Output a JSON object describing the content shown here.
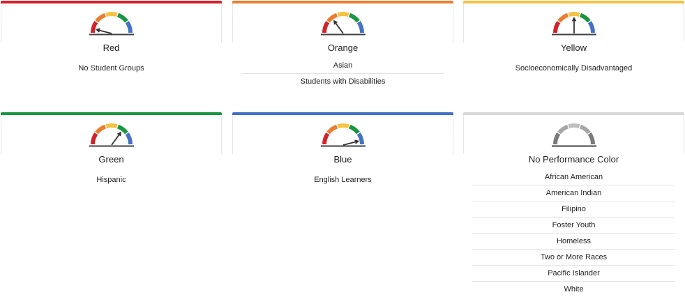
{
  "cards": [
    {
      "title": "Red",
      "bar_color": "#d1232a",
      "needle_value": 0.08,
      "gauge_style": "color",
      "groups": [
        "No Student Groups"
      ]
    },
    {
      "title": "Orange",
      "bar_color": "#ec7c30",
      "needle_value": 0.3,
      "gauge_style": "color",
      "groups": [
        "Asian",
        "Students with Disabilities"
      ]
    },
    {
      "title": "Yellow",
      "bar_color": "#f5c242",
      "needle_value": 0.5,
      "gauge_style": "color",
      "groups": [
        "Socioeconomically Disadvantaged"
      ]
    },
    {
      "title": "Green",
      "bar_color": "#1a9641",
      "needle_value": 0.7,
      "gauge_style": "color",
      "groups": [
        "Hispanic"
      ]
    },
    {
      "title": "Blue",
      "bar_color": "#4472c4",
      "needle_value": 0.92,
      "gauge_style": "color",
      "groups": [
        "English Learners"
      ]
    },
    {
      "title": "No Performance Color",
      "bar_color": "#d9d9d9",
      "needle_value": null,
      "gauge_style": "gray",
      "groups": [
        "African American",
        "American Indian",
        "Filipino",
        "Foster Youth",
        "Homeless",
        "Two or More Races",
        "Pacific Islander",
        "White"
      ]
    }
  ],
  "gauge_colors": [
    "#d1232a",
    "#ec7c30",
    "#f5c242",
    "#1a9641",
    "#4472c4"
  ],
  "gauge_gray_colors": [
    "#7a7a7a",
    "#a6a6a6",
    "#bfbfbf",
    "#a6a6a6",
    "#7a7a7a"
  ]
}
